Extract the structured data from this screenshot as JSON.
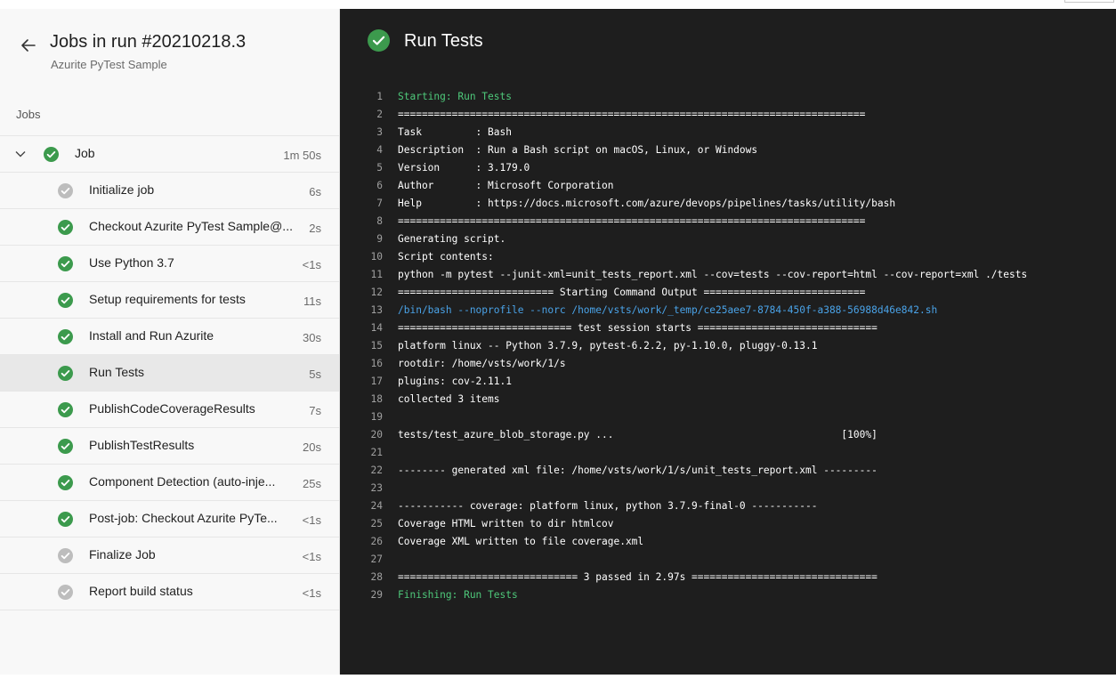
{
  "colors": {
    "success": "#3c9a4d",
    "pending": "#bdbdbd",
    "log_green": "#4ec87a",
    "log_link": "#4aa3e8"
  },
  "header": {
    "title": "Jobs in run #20210218.3",
    "subtitle": "Azurite PyTest Sample"
  },
  "jobs_label": "Jobs",
  "job": {
    "name": "Job",
    "duration": "1m 50s",
    "status": "success"
  },
  "steps": [
    {
      "label": "Initialize job",
      "duration": "6s",
      "status": "pending"
    },
    {
      "label": "Checkout Azurite PyTest Sample@...",
      "duration": "2s",
      "status": "success"
    },
    {
      "label": "Use Python 3.7",
      "duration": "<1s",
      "status": "success"
    },
    {
      "label": "Setup requirements for tests",
      "duration": "11s",
      "status": "success"
    },
    {
      "label": "Install and Run Azurite",
      "duration": "30s",
      "status": "success"
    },
    {
      "label": "Run Tests",
      "duration": "5s",
      "status": "success",
      "selected": true
    },
    {
      "label": "PublishCodeCoverageResults",
      "duration": "7s",
      "status": "success"
    },
    {
      "label": "PublishTestResults",
      "duration": "20s",
      "status": "success"
    },
    {
      "label": "Component Detection (auto-inje...",
      "duration": "25s",
      "status": "success"
    },
    {
      "label": "Post-job: Checkout Azurite PyTe...",
      "duration": "<1s",
      "status": "success"
    },
    {
      "label": "Finalize Job",
      "duration": "<1s",
      "status": "pending"
    },
    {
      "label": "Report build status",
      "duration": "<1s",
      "status": "pending"
    }
  ],
  "log": {
    "title": "Run Tests",
    "lines": [
      {
        "n": "1",
        "t": "Starting: Run Tests",
        "style": "green"
      },
      {
        "n": "2",
        "t": "=============================================================================="
      },
      {
        "n": "3",
        "t": "Task         : Bash"
      },
      {
        "n": "4",
        "t": "Description  : Run a Bash script on macOS, Linux, or Windows"
      },
      {
        "n": "5",
        "t": "Version      : 3.179.0"
      },
      {
        "n": "6",
        "t": "Author       : Microsoft Corporation"
      },
      {
        "n": "7",
        "t": "Help         : ",
        "link": "https://docs.microsoft.com/azure/devops/pipelines/tasks/utility/bash"
      },
      {
        "n": "8",
        "t": "=============================================================================="
      },
      {
        "n": "9",
        "t": "Generating script."
      },
      {
        "n": "10",
        "t": "Script contents:"
      },
      {
        "n": "11",
        "t": "python -m pytest --junit-xml=unit_tests_report.xml --cov=tests --cov-report=html --cov-report=xml ./tests"
      },
      {
        "n": "12",
        "t": "========================== Starting Command Output ==========================="
      },
      {
        "n": "13",
        "t": "/bin/bash --noprofile --norc /home/vsts/work/_temp/ce25aee7-8784-450f-a388-56988d46e842.sh",
        "style": "link"
      },
      {
        "n": "14",
        "t": "============================= test session starts =============================="
      },
      {
        "n": "15",
        "t": "platform linux -- Python 3.7.9, pytest-6.2.2, py-1.10.0, pluggy-0.13.1"
      },
      {
        "n": "16",
        "t": "rootdir: /home/vsts/work/1/s"
      },
      {
        "n": "17",
        "t": "plugins: cov-2.11.1"
      },
      {
        "n": "18",
        "t": "collected 3 items"
      },
      {
        "n": "19",
        "t": ""
      },
      {
        "n": "20",
        "t": "tests/test_azure_blob_storage.py ...                                      [100%]"
      },
      {
        "n": "21",
        "t": ""
      },
      {
        "n": "22",
        "t": "-------- generated xml file: /home/vsts/work/1/s/unit_tests_report.xml ---------"
      },
      {
        "n": "23",
        "t": ""
      },
      {
        "n": "24",
        "t": "----------- coverage: platform linux, python 3.7.9-final-0 -----------"
      },
      {
        "n": "25",
        "t": "Coverage HTML written to dir htmlcov"
      },
      {
        "n": "26",
        "t": "Coverage XML written to file coverage.xml"
      },
      {
        "n": "27",
        "t": ""
      },
      {
        "n": "28",
        "t": "============================== 3 passed in 2.97s ==============================="
      },
      {
        "n": "29",
        "t": "Finishing: Run Tests",
        "style": "green"
      }
    ]
  }
}
